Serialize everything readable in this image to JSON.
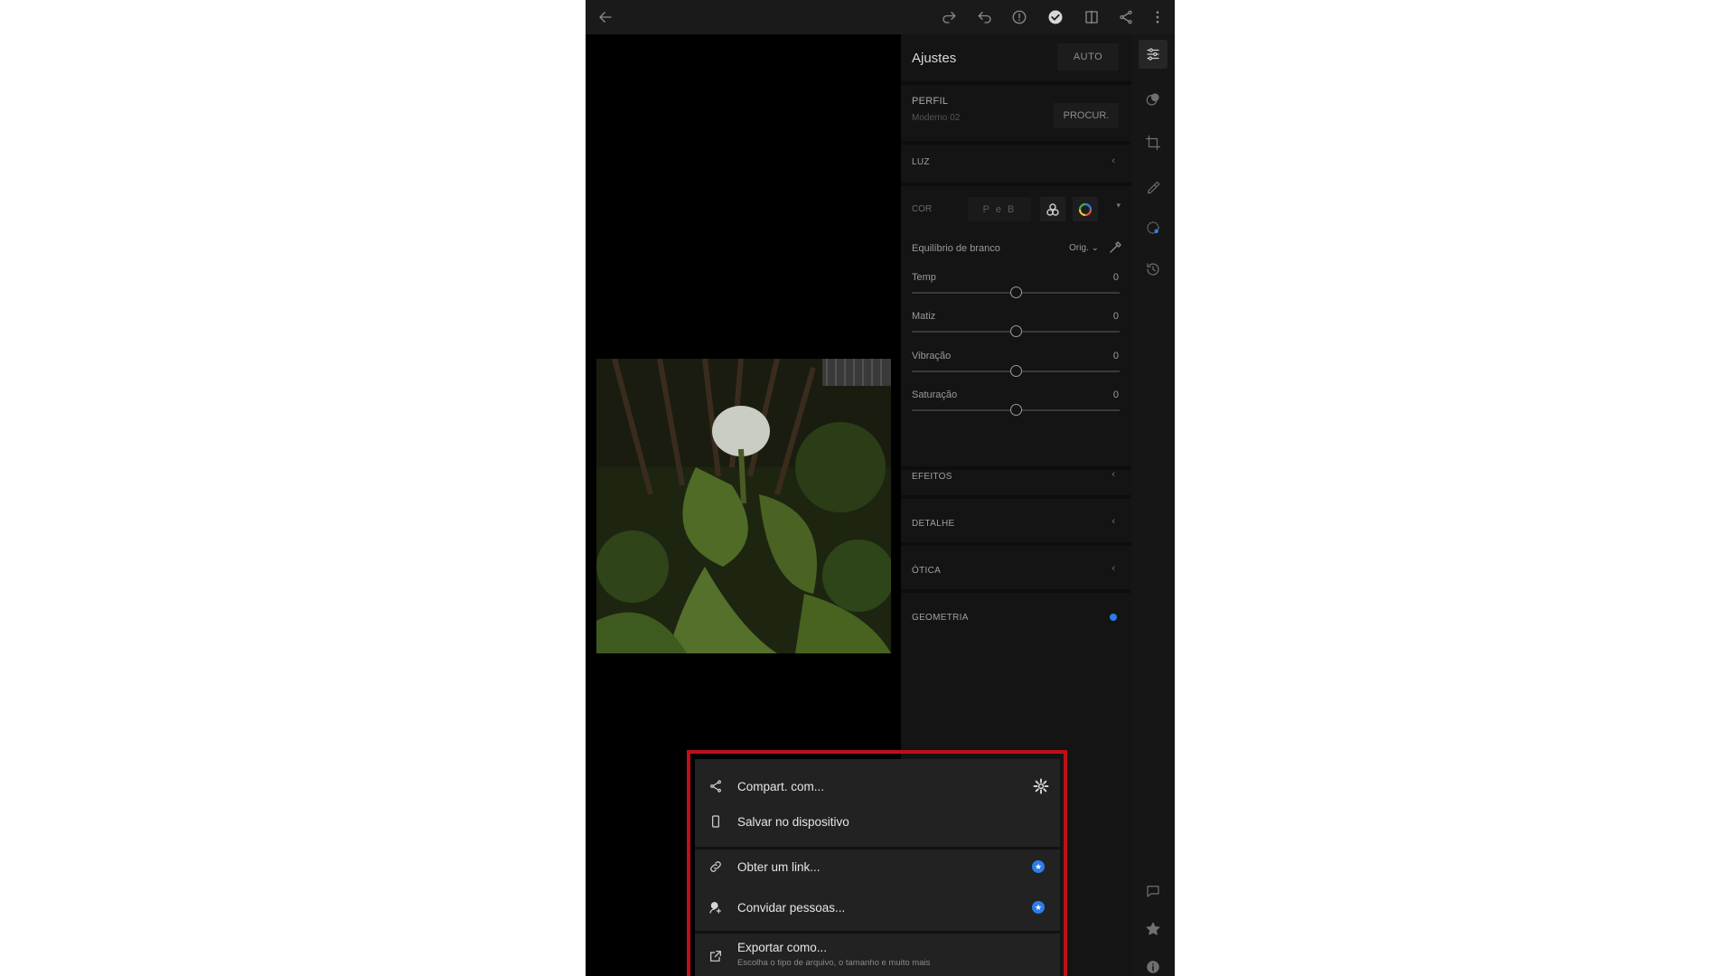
{
  "panel": {
    "title": "Ajustes",
    "auto_label": "AUTO",
    "profile": {
      "label": "PERFIL",
      "value": "Moderno 02",
      "browse_label": "PROCUR."
    },
    "sections": {
      "luz": "LUZ",
      "cor": "COR",
      "efeitos": "EFEITOS",
      "detalhe": "DETALHE",
      "otica": "ÓTICA",
      "geometria": "GEOMETRIA"
    },
    "bw_label": "P e B",
    "white_balance": {
      "label": "Equilíbrio de branco",
      "value": "Orig."
    },
    "sliders": [
      {
        "label": "Temp",
        "value": "0",
        "position": 0.5
      },
      {
        "label": "Matiz",
        "value": "0",
        "position": 0.5
      },
      {
        "label": "Vibração",
        "value": "0",
        "position": 0.5
      },
      {
        "label": "Saturação",
        "value": "0",
        "position": 0.5
      }
    ]
  },
  "share_menu": {
    "share_with": "Compart. com...",
    "save_device": "Salvar no dispositivo",
    "get_link": "Obter um link...",
    "invite": "Convidar pessoas...",
    "export_as": "Exportar como...",
    "export_sub": "Escolha o tipo de arquivo, o tamanho e muito mais"
  },
  "colors": {
    "accent_blue": "#2b7de9",
    "highlight_red": "#c00f16",
    "panel_bg": "#141414"
  }
}
